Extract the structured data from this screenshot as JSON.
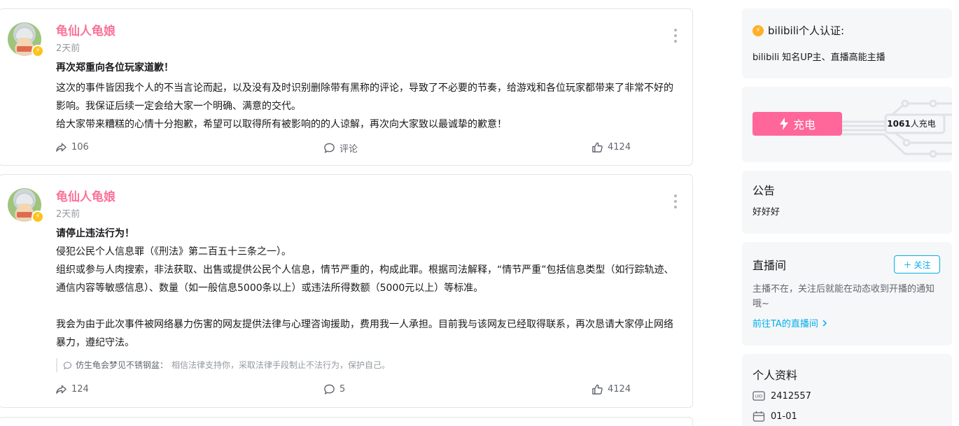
{
  "posts": [
    {
      "author": "龟仙人龟娘",
      "time": "2天前",
      "title": "再次郑重向各位玩家道歉！",
      "body": "这次的事件皆因我个人的不当言论而起，以及没有及时识别删除带有黑称的评论，导致了不必要的节奏，给游戏和各位玩家都带来了非常不好的影响。我保证后续一定会给大家一个明确、满意的交代。\n给大家带来糟糕的心情十分抱歉，希望可以取得所有被影响的的人谅解，再次向大家致以最诚挚的歉意！",
      "forward_count": "106",
      "comment_label": "评论",
      "like_count": "4124"
    },
    {
      "author": "龟仙人龟娘",
      "time": "2天前",
      "title": "请停止违法行为！",
      "body": "侵犯公民个人信息罪（《刑法》第二百五十三条之一）。\n组织或参与人肉搜索，非法获取、出售或提供公民个人信息，情节严重的，构成此罪。根据司法解释，“情节严重”包括信息类型（如行踪轨迹、通信内容等敏感信息）、数量（如一般信息5000条以上）或违法所得数额（5000元以上）等标准。\n\n我会为由于此次事件被网络暴力伤害的网友提供法律与心理咨询援助，费用我一人承担。目前我与该网友已经取得联系，再次恳请大家停止网络暴力，遵纪守法。",
      "quote_user": "仿生龟会梦见不锈钢盆：",
      "quote_text": "相信法律支持你，采取法律手段制止不法行为，保护自己。",
      "forward_count": "124",
      "comment_label": "5",
      "like_count": "4124"
    }
  ],
  "sidebar": {
    "auth_title": "bilibili个人认证:",
    "auth_desc": "bilibili 知名UP主、直播高能主播",
    "charge_label": "充电",
    "charge_count": "1061",
    "charge_suffix": "人充电",
    "notice_title": "公告",
    "notice_text": "好好好",
    "live_title": "直播间",
    "follow_label": "关注",
    "live_tip": "主播不在，关注后就能在动态收到开播的通知哦~",
    "live_link": "前往TA的直播间",
    "profile_title": "个人资料",
    "uid": "2412557",
    "birthday": "01-01"
  },
  "colors": {
    "accent_pink": "#fb7299",
    "charge_pink": "#ff6699",
    "link_blue": "#00aeec",
    "gold": "#ffc21a"
  },
  "icons": [
    "forward-icon",
    "comment-icon",
    "like-icon",
    "more-icon",
    "lightning-icon",
    "uid-icon",
    "calendar-icon",
    "chevron-right-icon",
    "plus-icon"
  ]
}
